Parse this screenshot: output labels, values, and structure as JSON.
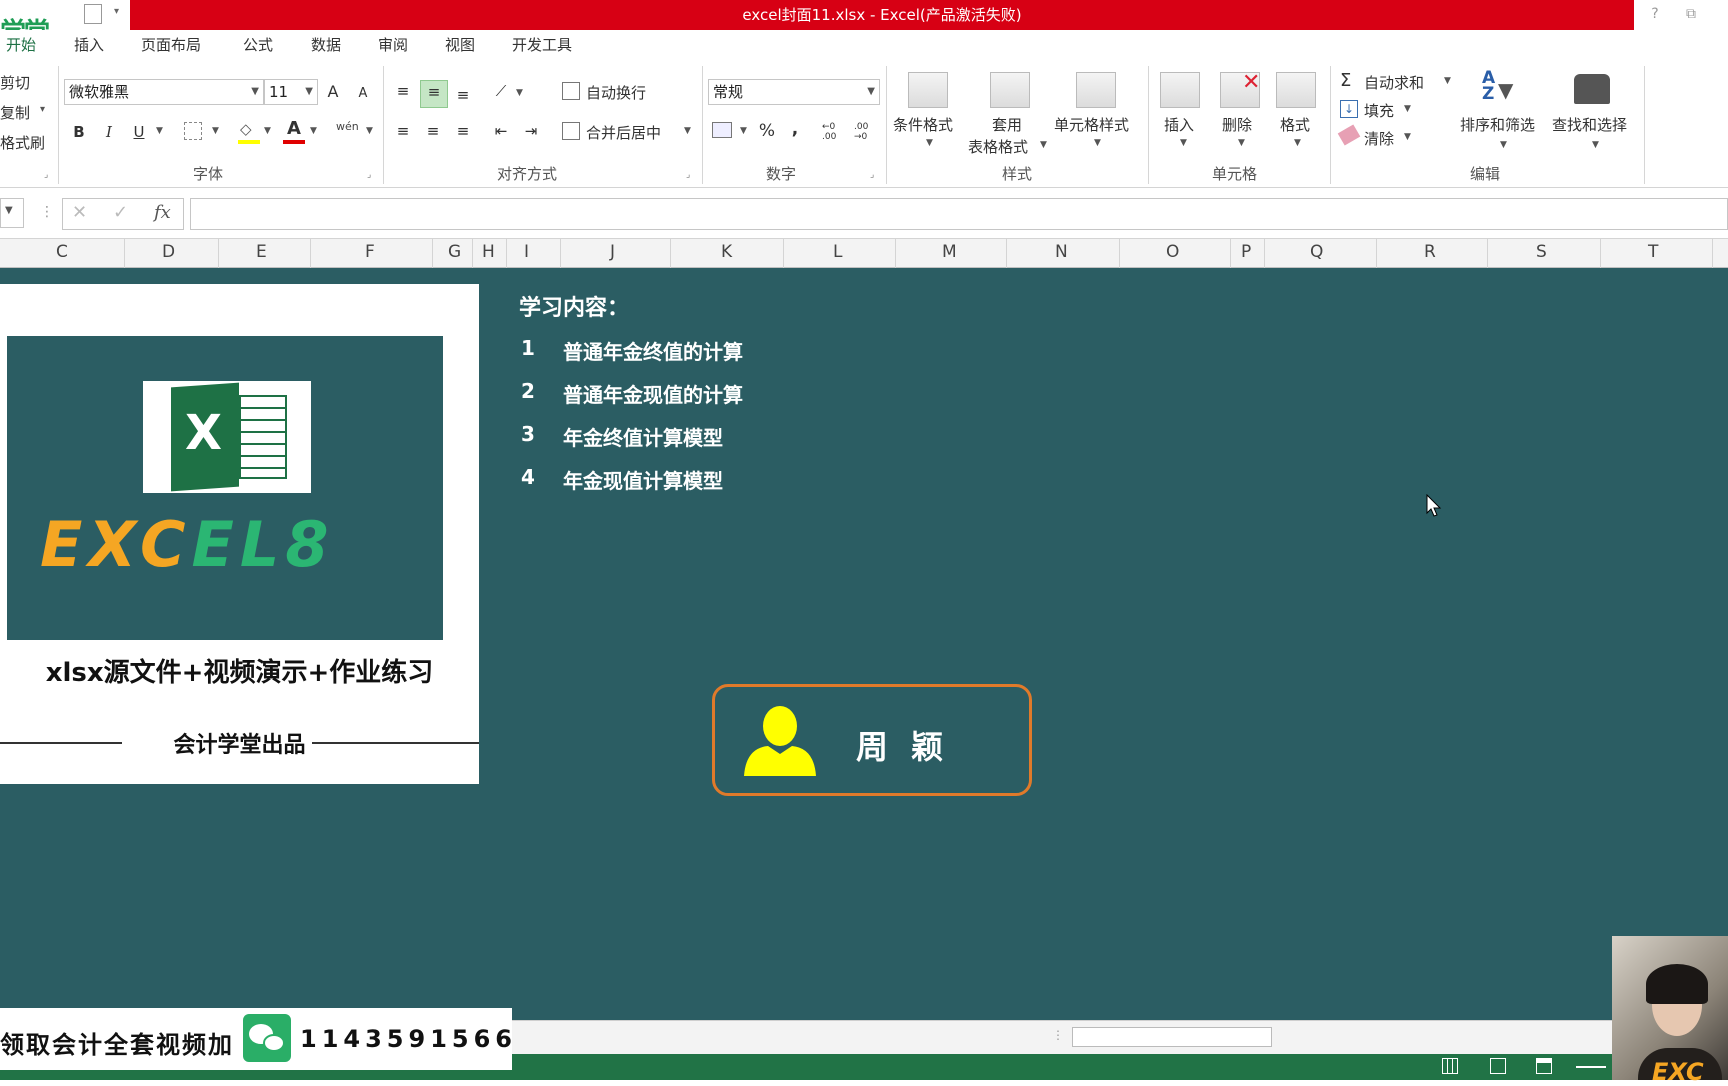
{
  "window": {
    "title": "excel封面11.xlsx -  Excel(产品激活失败)",
    "logo_fragment": "学堂",
    "help": "?",
    "restore": "⧉"
  },
  "tabs": [
    "开始",
    "插入",
    "页面布局",
    "公式",
    "数据",
    "审阅",
    "视图",
    "开发工具"
  ],
  "clipboard": {
    "cut": "剪切",
    "copy": "复制",
    "format_painter": "格式刷"
  },
  "font": {
    "name": "微软雅黑",
    "size": "11",
    "group_label": "字体",
    "bold": "B",
    "italic": "I",
    "underline": "U",
    "grow": "A",
    "shrink": "A",
    "font_color_letter": "A",
    "phonetic": "wén"
  },
  "alignment": {
    "wrap_text": "自动换行",
    "merge_center": "合并后居中",
    "group_label": "对齐方式"
  },
  "number": {
    "format": "常规",
    "percent": "%",
    "comma": ",",
    "inc_decimal": "←0 .00",
    "dec_decimal": ".00 →0",
    "group_label": "数字"
  },
  "styles": {
    "conditional": "条件格式",
    "table_format_1": "套用",
    "table_format_2": "表格格式",
    "cell_styles": "单元格样式",
    "group_label": "样式"
  },
  "cells": {
    "insert": "插入",
    "delete": "删除",
    "format": "格式",
    "group_label": "单元格"
  },
  "editing": {
    "autosum": "自动求和",
    "fill": "填充",
    "clear": "清除",
    "sort_filter": "排序和筛选",
    "find_select": "查找和选择",
    "group_label": "编辑"
  },
  "formula_bar": {
    "cancel": "✕",
    "enter": "✓",
    "fx": "fx"
  },
  "columns": [
    "C",
    "D",
    "E",
    "F",
    "G",
    "H",
    "I",
    "J",
    "K",
    "L",
    "M",
    "N",
    "O",
    "P",
    "Q",
    "R",
    "S",
    "T"
  ],
  "card": {
    "brand": "EXCEL8",
    "subtitle": "xlsx源文件+视频演示+作业练习",
    "footer": "会计学堂出品",
    "icon_letter": "X"
  },
  "content": {
    "title": "学习内容：",
    "items": [
      {
        "num": "1",
        "text": "普通年金终值的计算"
      },
      {
        "num": "2",
        "text": "普通年金现值的计算"
      },
      {
        "num": "3",
        "text": "年金终值计算模型"
      },
      {
        "num": "4",
        "text": "年金现值计算模型"
      }
    ]
  },
  "presenter": {
    "name": "周 颖"
  },
  "promo": {
    "text": "领取会计全套视频加",
    "number": "1143591566"
  },
  "colors": {
    "sheet_bg": "#2b5d63",
    "title_red": "#d70014",
    "accent_orange": "#e07a2a",
    "excel_green": "#217346",
    "brand_orange": "#f5a623",
    "brand_green": "#2bb673"
  }
}
